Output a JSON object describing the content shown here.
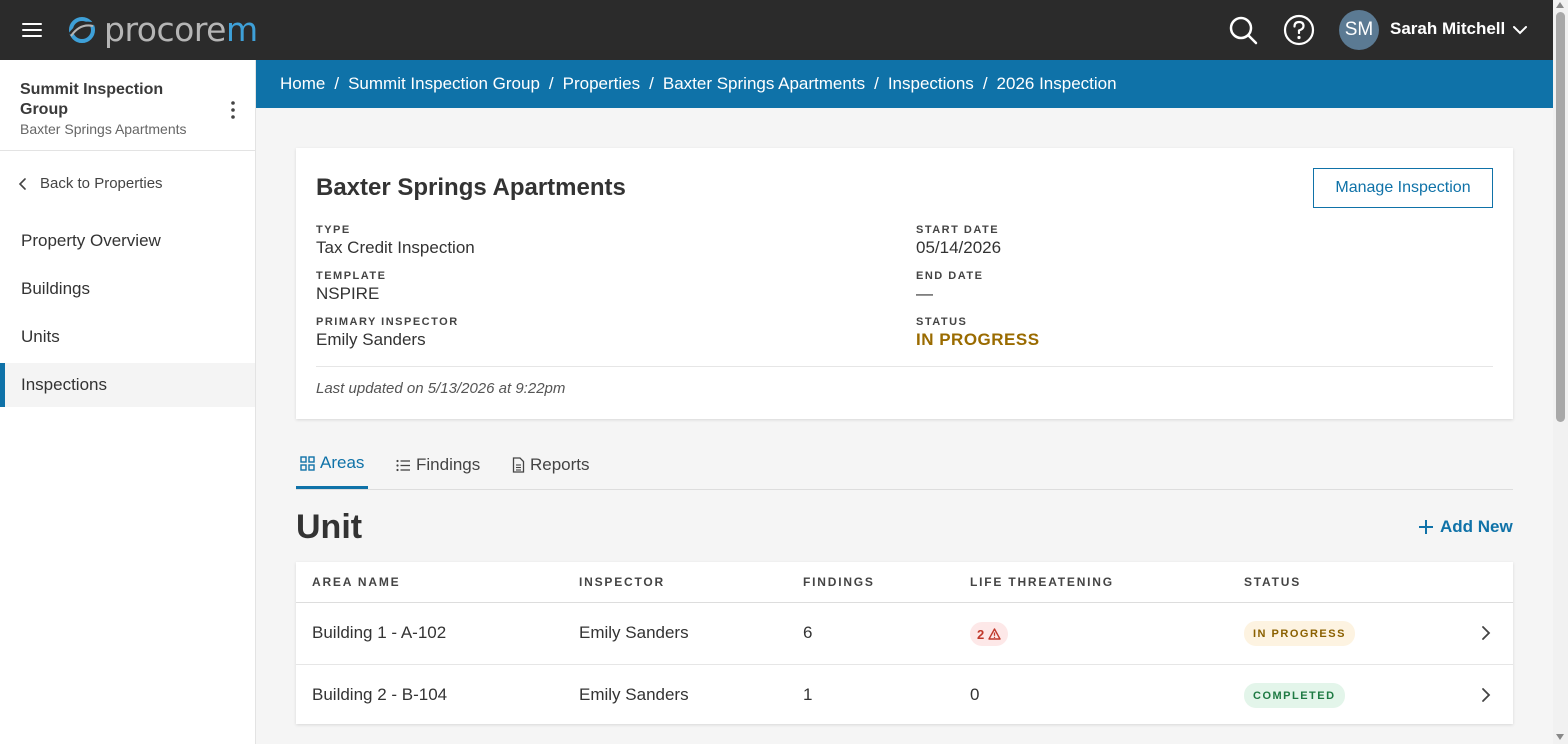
{
  "topbar": {
    "logo_text_main": "procore",
    "logo_text_accent": "m",
    "search_icon": "search-icon",
    "help_icon": "help-circle-icon",
    "user_initials": "SM",
    "user_name": "Sarah Mitchell"
  },
  "sidebar": {
    "org_name": "Summit Inspection Group",
    "property_name": "Baxter Springs Apartments",
    "back_label": "Back to Properties",
    "items": [
      {
        "label": "Property Overview"
      },
      {
        "label": "Buildings"
      },
      {
        "label": "Units"
      },
      {
        "label": "Inspections"
      }
    ],
    "active_item": "Inspections"
  },
  "breadcrumb": [
    "Home",
    "Summit Inspection Group",
    "Properties",
    "Baxter Springs Apartments",
    "Inspections",
    "2026 Inspection"
  ],
  "summary": {
    "title": "Baxter Springs Apartments",
    "manage_label": "Manage Inspection",
    "type_label": "TYPE",
    "type_value": "Tax Credit Inspection",
    "template_label": "TEMPLATE",
    "template_value": "NSPIRE",
    "inspector_label": "PRIMARY INSPECTOR",
    "inspector_value": "Emily Sanders",
    "start_label": "START DATE",
    "start_value": "05/14/2026",
    "end_label": "END DATE",
    "end_value": "—",
    "status_label": "STATUS",
    "status_value": "IN PROGRESS",
    "status_color": "#9a6b00",
    "last_updated": "Last updated on 5/13/2026 at 9:22pm"
  },
  "tabs": [
    {
      "label": "Areas",
      "icon": "grid-icon",
      "active": true
    },
    {
      "label": "Findings",
      "icon": "list-icon",
      "active": false
    },
    {
      "label": "Reports",
      "icon": "document-icon",
      "active": false
    }
  ],
  "section": {
    "title": "Unit",
    "add_label": "Add New"
  },
  "table": {
    "columns": [
      "AREA NAME",
      "INSPECTOR",
      "FINDINGS",
      "LIFE THREATENING",
      "STATUS"
    ],
    "rows": [
      {
        "area": "Building 1 - A-102",
        "inspector": "Emily Sanders",
        "findings": "6",
        "life_threatening": "2",
        "life_threatening_warning": true,
        "status": "IN PROGRESS"
      },
      {
        "area": "Building 2 - B-104",
        "inspector": "Emily Sanders",
        "findings": "1",
        "life_threatening": "0",
        "life_threatening_warning": false,
        "status": "COMPLETED"
      }
    ]
  },
  "colors": {
    "topbar": "#2b2b2b",
    "accent": "#0f72a8",
    "in_progress": "#8a6000",
    "completed": "#1e7a43",
    "danger": "#c0392b"
  }
}
